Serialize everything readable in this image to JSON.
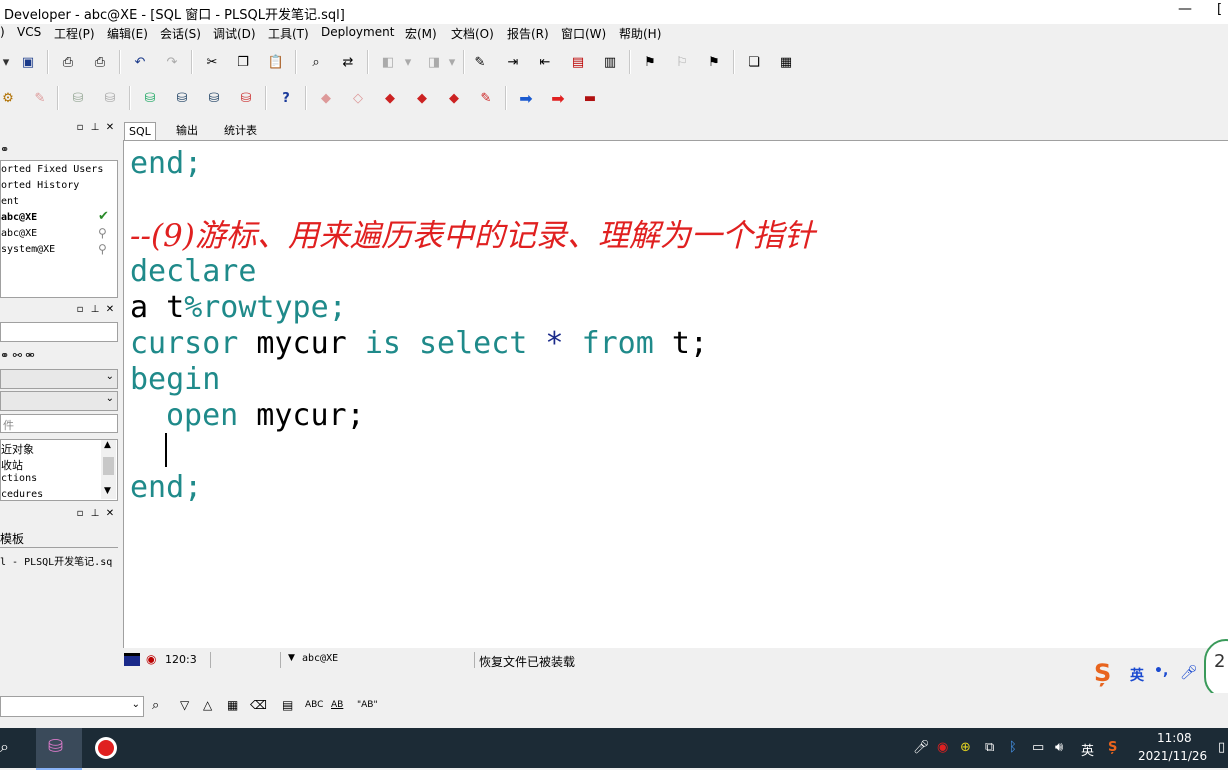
{
  "window": {
    "title": "Developer - abc@XE - [SQL 窗口 - PLSQL开发笔记.sql]",
    "minimize": "—",
    "maximize": "["
  },
  "menu": [
    "VCS",
    "工程(P)",
    "编辑(E)",
    "会话(S)",
    "调试(D)",
    "工具(T)",
    "Deployment",
    "宏(M)",
    "文档(O)",
    "报告(R)",
    "窗口(W)",
    "帮助(H)"
  ],
  "menu_lead": ")",
  "left_panel": {
    "connections": [
      "orted Fixed Users",
      "orted History",
      "ent",
      "abc@XE",
      "abc@XE",
      "system@XE"
    ],
    "filter_value": "",
    "doc_placeholder": "件",
    "objects": [
      "近对象",
      "收站",
      "ctions",
      "cedures"
    ],
    "templates_label": "模板",
    "file_item": "l - PLSQL开发笔记.sq"
  },
  "tabs": [
    "SQL",
    "输出",
    "统计表"
  ],
  "editor": {
    "line1": "end;",
    "comment": "--(9)游标、用来遍历表中的记录、理解为一个指针",
    "declare": "declare",
    "line_a_prefix": "a t",
    "line_a_suffix": "%rowtype;",
    "cursor_kw": "cursor",
    "cursor_name": " mycur ",
    "is_kw": "is",
    "select_kw": " select",
    "star": " * ",
    "from_kw": "from",
    "table_end": " t;",
    "begin": "begin",
    "open_kw": "open",
    "open_rest": " mycur;",
    "end2": "end;"
  },
  "status": {
    "position": "120:3",
    "connection": "abc@XE",
    "message": "恢复文件已被装载"
  },
  "findbar": {
    "abc1": "ABC",
    "abc2": "AB",
    "quote_ab": "\"AB\""
  },
  "ime": {
    "lang": "英",
    "punct": "•,"
  },
  "taskbar": {
    "time": "11:08",
    "date": "2021/11/26",
    "lang": "英"
  },
  "overlay_digit": "2"
}
